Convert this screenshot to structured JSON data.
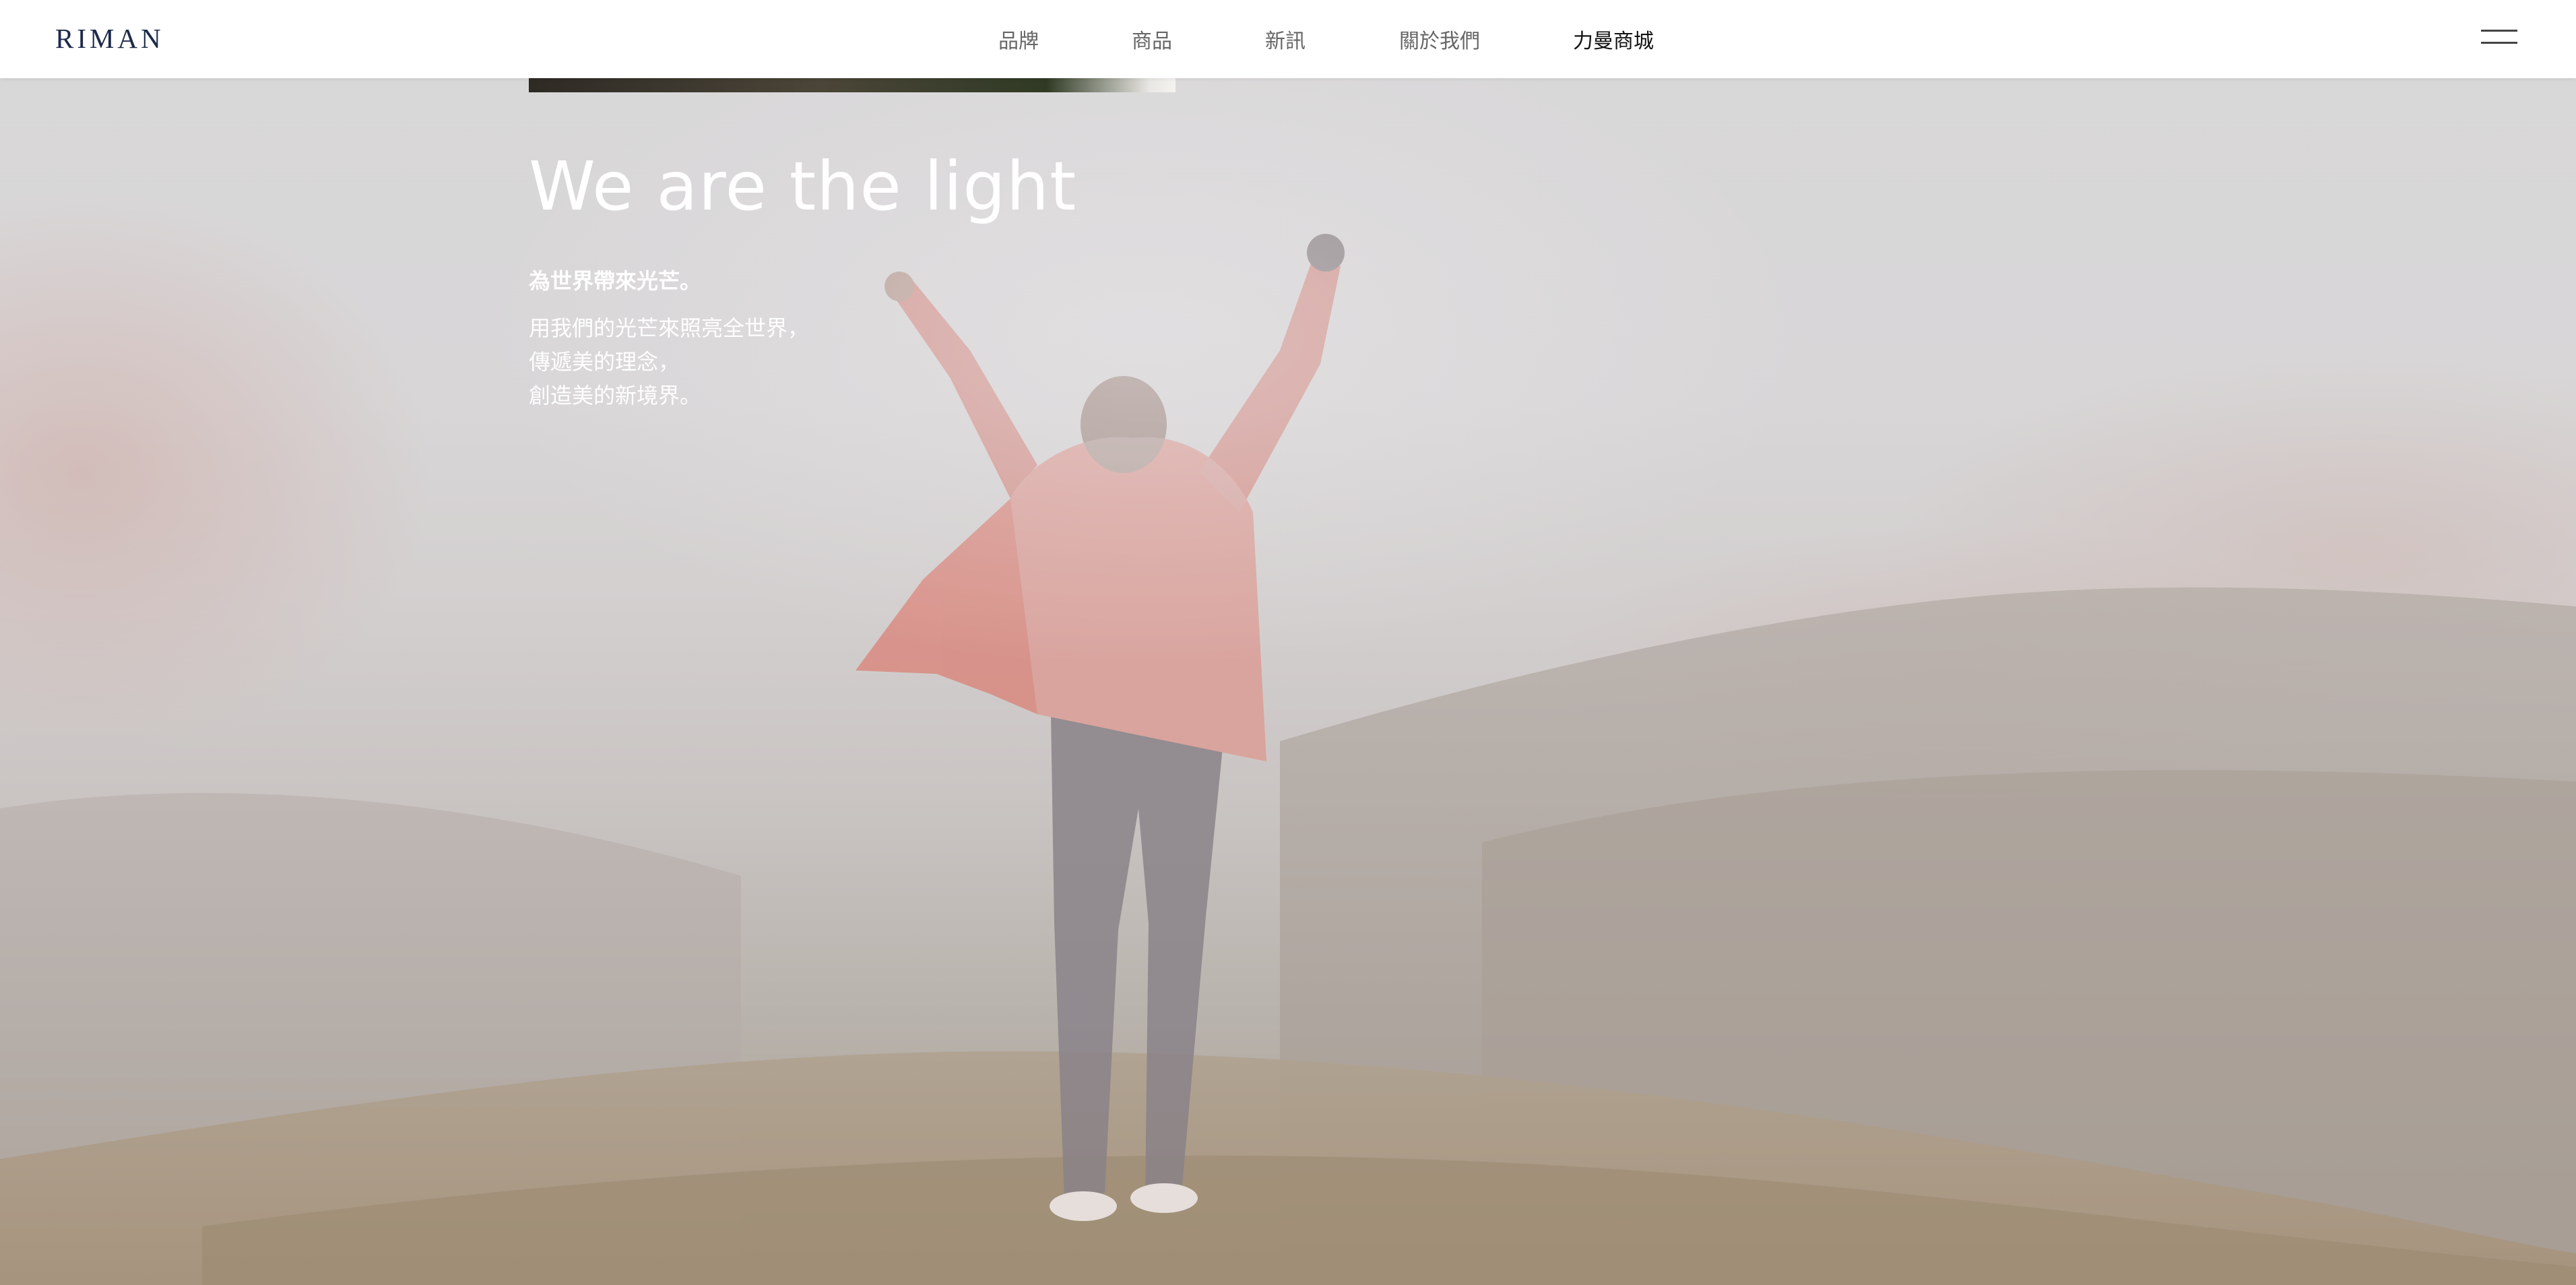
{
  "header": {
    "logo": "RIMAN",
    "nav": [
      {
        "label": "品牌",
        "active": false
      },
      {
        "label": "商品",
        "active": false
      },
      {
        "label": "新訊",
        "active": false
      },
      {
        "label": "關於我們",
        "active": false
      },
      {
        "label": "力曼商城",
        "active": true
      }
    ],
    "menu_icon": "hamburger-menu-icon"
  },
  "hero": {
    "title": "We are the light",
    "subtitle": "為世界帶來光芒。",
    "body_lines": [
      "用我們的光芒來照亮全世界，",
      "傳遞美的理念，",
      "創造美的新境界。"
    ]
  },
  "colors": {
    "logo": "#1e2a4a",
    "nav_text": "#666666",
    "nav_active": "#111111",
    "hero_text": "#ffffff",
    "jacket": "#d98a80"
  }
}
